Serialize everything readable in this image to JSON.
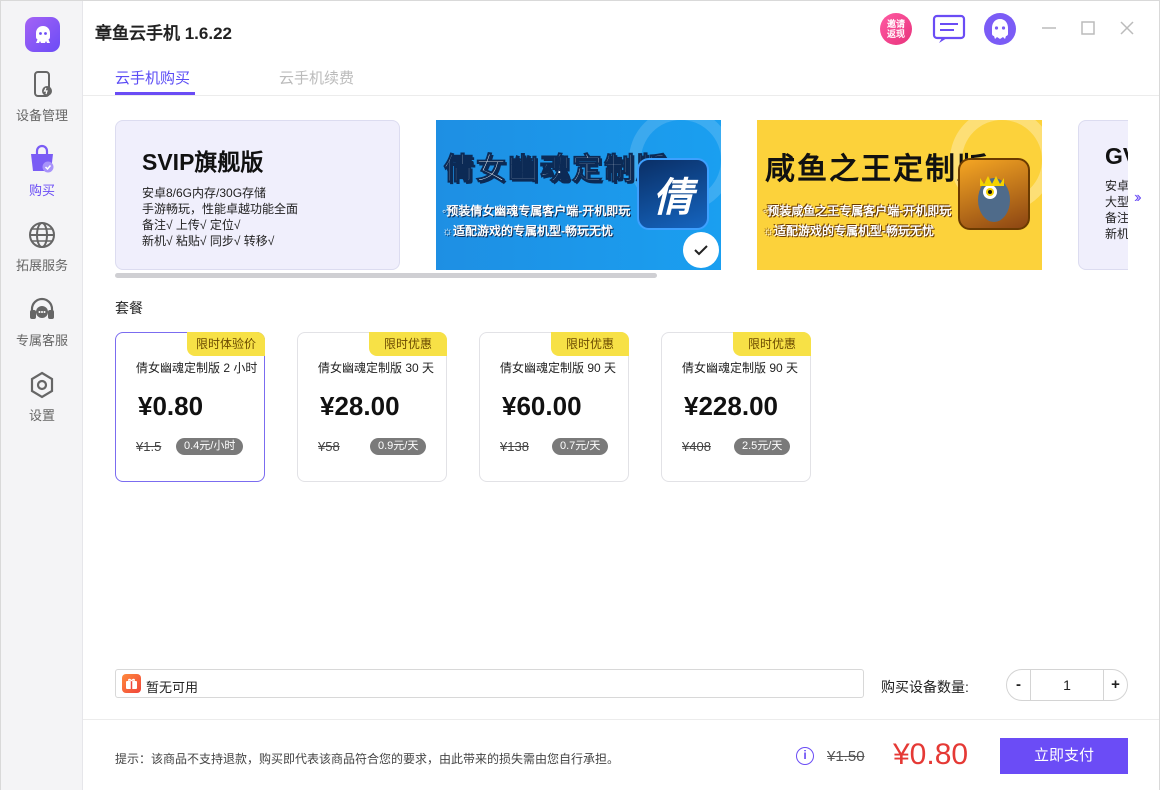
{
  "app": {
    "title": "章鱼云手机 1.6.22"
  },
  "titlebar": {
    "invite_badge": "邀请返现"
  },
  "sidebar": {
    "items": [
      {
        "label": "设备管理",
        "icon": "phone-icon"
      },
      {
        "label": "购买",
        "icon": "shopping-bag-icon"
      },
      {
        "label": "拓展服务",
        "icon": "globe-icon"
      },
      {
        "label": "专属客服",
        "icon": "headset-icon"
      },
      {
        "label": "设置",
        "icon": "gear-icon"
      }
    ],
    "active_index": 1
  },
  "tabs": [
    {
      "label": "云手机购买",
      "active": true
    },
    {
      "label": "云手机续费",
      "active": false
    }
  ],
  "banners": {
    "svip": {
      "title": "SVIP旗舰版",
      "lines": [
        "安卓8/6G内存/30G存储",
        "手游畅玩，性能卓越功能全面",
        "备注√ 上传√ 定位√",
        "新机√ 粘贴√ 同步√ 转移√"
      ]
    },
    "qiannv": {
      "title": "倩女幽魂定制版",
      "line1": "◦预装倩女幽魂专属客户端-开机即玩",
      "line2": "☼适配游戏的专属机型-畅玩无忧",
      "icon_char": "倩"
    },
    "xianyu": {
      "title": "咸鱼之王定制版",
      "line1": "◦预装咸鱼之王专属客户端-开机即玩",
      "line2": "☼适配游戏的专属机型-畅玩无忧"
    },
    "partial": {
      "title": "GV",
      "lines": [
        "安卓",
        "大型",
        "备注",
        "新机"
      ]
    },
    "next_arrow": "››"
  },
  "section_label": "套餐",
  "packages": [
    {
      "tag": "限时体验价",
      "name": "倩女幽魂定制版 2 小时",
      "price": "¥0.80",
      "original": "¥1.5",
      "unit": "0.4元/小时",
      "selected": true
    },
    {
      "tag": "限时优惠",
      "name": "倩女幽魂定制版 30 天",
      "price": "¥28.00",
      "original": "¥58",
      "unit": "0.9元/天",
      "selected": false
    },
    {
      "tag": "限时优惠",
      "name": "倩女幽魂定制版 90 天",
      "price": "¥60.00",
      "original": "¥138",
      "unit": "0.7元/天",
      "selected": false
    },
    {
      "tag": "限时优惠",
      "name": "倩女幽魂定制版 90 天",
      "price": "¥228.00",
      "original": "¥408",
      "unit": "2.5元/天",
      "selected": false
    }
  ],
  "coupon": {
    "text": "暂无可用"
  },
  "quantity": {
    "label": "购买设备数量:",
    "value": "1",
    "minus": "-",
    "plus": "+"
  },
  "footer": {
    "tip": "提示：该商品不支持退款，购买即代表该商品符合您的要求，由此带来的损失需由您自行承担。",
    "info": "i",
    "original_total": "¥1.50",
    "total": "¥0.80",
    "pay_label": "立即支付"
  },
  "colors": {
    "accent": "#6b4cf6",
    "price_red": "#e53935",
    "tag_yellow": "#f7e146"
  }
}
